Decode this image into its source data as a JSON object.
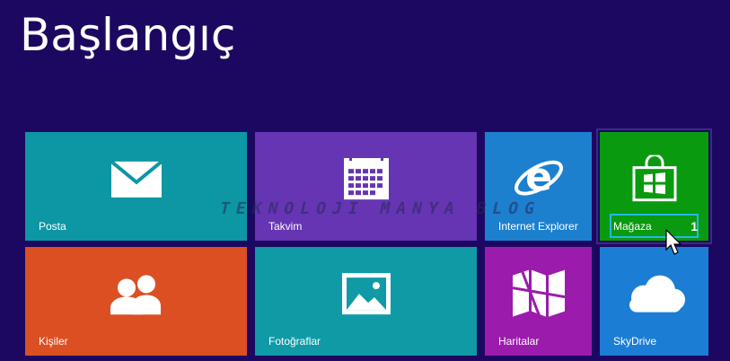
{
  "screen": {
    "title": "Başlangıç",
    "watermark": "TEKNOLOJI MANYA BLOG"
  },
  "tiles": [
    {
      "label": "Posta",
      "color": "#0d96a3",
      "icon": "mail-icon"
    },
    {
      "label": "Takvim",
      "color": "#6535b3",
      "icon": "calendar-icon"
    },
    {
      "label": "Internet Explorer",
      "color": "#1c80cf",
      "icon": "internet-explorer-icon"
    },
    {
      "label": "Mağaza",
      "color": "#0a9a0f",
      "icon": "store-icon",
      "badge": "1"
    },
    {
      "label": "Kişiler",
      "color": "#db4f23",
      "icon": "people-icon"
    },
    {
      "label": "Fotoğraflar",
      "color": "#0f9aa6",
      "icon": "photos-icon"
    },
    {
      "label": "Haritalar",
      "color": "#9b1bac",
      "icon": "maps-icon"
    },
    {
      "label": "SkyDrive",
      "color": "#1c7dd4",
      "icon": "cloud-icon"
    }
  ]
}
